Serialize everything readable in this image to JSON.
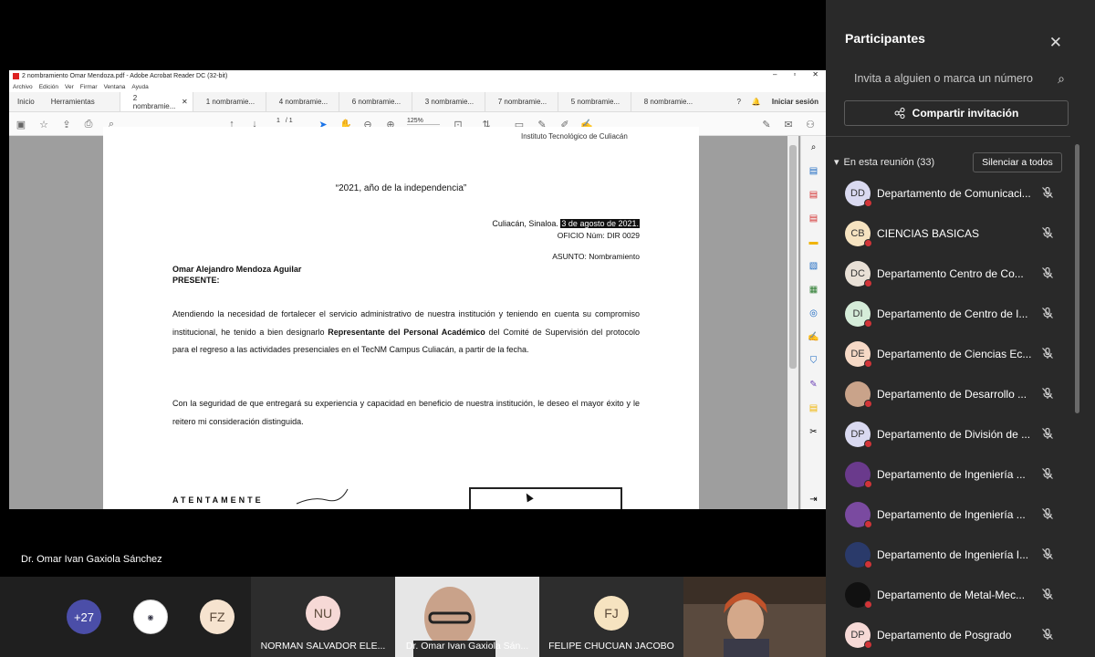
{
  "acrobat": {
    "window_title": "2 nombramiento Omar Mendoza.pdf - Adobe Acrobat Reader DC (32-bit)",
    "menu": [
      "Archivo",
      "Edición",
      "Ver",
      "Firmar",
      "Ventana",
      "Ayuda"
    ],
    "tabs": {
      "home": "Inicio",
      "tools": "Herramientas",
      "docs": [
        "2 nombramie...",
        "1 nombramie...",
        "4 nombramie...",
        "6 nombramie...",
        "3 nombramie...",
        "7 nombramie...",
        "5 nombramie...",
        "8 nombramie..."
      ],
      "signin": "Iniciar sesión"
    },
    "page_current": "1",
    "page_total": "/ 1",
    "zoom": "125%"
  },
  "document": {
    "institution": "Instituto Tecnológico de Culiacán",
    "motto": "“2021, año de la independencia”",
    "place": "Culiacán, Sinaloa.",
    "date": "3 de agosto de 2021.",
    "oficio": "OFICIO Núm: DIR 0029",
    "asunto": "ASUNTO: Nombramiento",
    "recipient": "Omar Alejandro Mendoza Aguilar",
    "presente": "PRESENTE:",
    "para1_a": "Atendiendo la necesidad de fortalecer el servicio administrativo de nuestra institución y teniendo en cuenta su compromiso institucional, he tenido a bien designarlo ",
    "para1_bold": "Representante del Personal Académico",
    "para1_b": " del Comité de Supervisión del protocolo para el regreso a las actividades presenciales en el TecNM Campus Culiacán, a partir de la fecha.",
    "para2": "Con la seguridad de que entregará su experiencia y capacidad en beneficio de nuestra institución, le deseo el mayor éxito y le reitero mi consideración distinguida.",
    "closing": "ATENTAMENTE"
  },
  "presenter": "Dr. Omar Ivan Gaxiola Sánchez",
  "gallery": {
    "more_count": "+27",
    "fz_initials": "FZ",
    "nu_initials": "NU",
    "nu_name": "NORMAN SALVADOR ELE...",
    "video_name": "Dr. Omar Ivan Gaxiola Sán...",
    "fj_initials": "FJ",
    "fj_name": "FELIPE CHUCUAN JACOBO"
  },
  "panel": {
    "title": "Participantes",
    "invite_placeholder": "Invita a alguien o marca un número",
    "share_label": "Compartir invitación",
    "in_meeting": "En esta reunión (33)",
    "mute_all": "Silenciar a todos",
    "participants": [
      {
        "initials": "DD",
        "name": "Departamento de Comunicaci...",
        "color": "#d9d9f0"
      },
      {
        "initials": "CB",
        "name": "CIENCIAS BASICAS",
        "color": "#f6e3c0"
      },
      {
        "initials": "DC",
        "name": "Departamento Centro de Co...",
        "color": "#e8e0d6"
      },
      {
        "initials": "DI",
        "name": "Departamento de Centro de I...",
        "color": "#d5ecd9"
      },
      {
        "initials": "DE",
        "name": "Departamento de Ciencias Ec...",
        "color": "#f6d9c6"
      },
      {
        "initials": "",
        "name": "Departamento de Desarrollo ...",
        "color": "#c9a38a"
      },
      {
        "initials": "DP",
        "name": "Departamento de División de ...",
        "color": "#d9d9f0"
      },
      {
        "initials": "",
        "name": "Departamento de Ingeniería ...",
        "color": "#6a3a8c"
      },
      {
        "initials": "",
        "name": "Departamento de Ingeniería ...",
        "color": "#7a4aa0"
      },
      {
        "initials": "",
        "name": "Departamento de Ingeniería I...",
        "color": "#2a3a6a"
      },
      {
        "initials": "",
        "name": "Departamento de Metal-Mec...",
        "color": "#111111"
      },
      {
        "initials": "DP",
        "name": "Departamento de Posgrado",
        "color": "#f6d9d6"
      }
    ]
  }
}
